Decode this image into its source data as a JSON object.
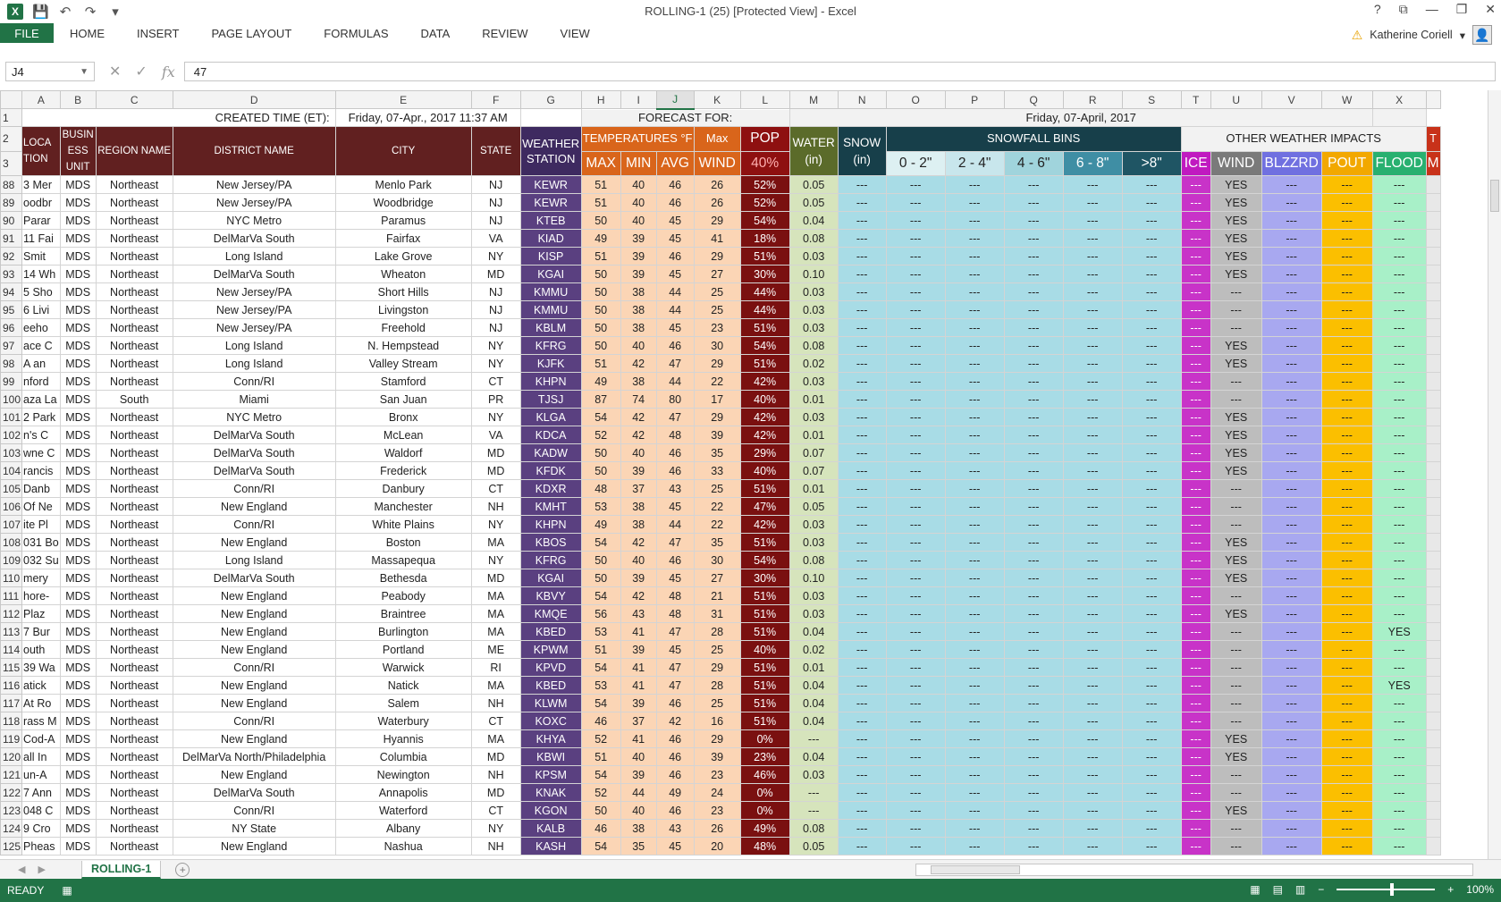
{
  "window": {
    "title": "ROLLING-1 (25)  [Protected View] - Excel",
    "help": "?",
    "controls": [
      "⧉",
      "—",
      "❐",
      "✕"
    ]
  },
  "qat": {
    "app_icon": "X",
    "save_icon": "save-icon",
    "undo_icon": "undo-icon",
    "redo_icon": "redo-icon",
    "customize_icon": "customize-icon"
  },
  "ribbon": {
    "file": "FILE",
    "tabs": [
      "HOME",
      "INSERT",
      "PAGE LAYOUT",
      "FORMULAS",
      "DATA",
      "REVIEW",
      "VIEW"
    ],
    "user": "Katherine Coriell"
  },
  "formula_bar": {
    "name_box": "J4",
    "fx": "fx",
    "value": "47"
  },
  "columns": [
    "A",
    "B",
    "C",
    "D",
    "E",
    "F",
    "G",
    "H",
    "I",
    "J",
    "K",
    "L",
    "M",
    "N",
    "O",
    "P",
    "Q",
    "R",
    "S",
    "T",
    "U",
    "V",
    "W",
    "X"
  ],
  "header": {
    "created_label": "CREATED TIME (ET):",
    "created_value": "Friday, 07-Apr., 2017 11:37 AM",
    "forecast_label": "FORECAST FOR:",
    "forecast_value": "Friday, 07-April, 2017",
    "location": "LOCA TION",
    "business_unit": "BUSIN ESS UNIT",
    "region": "REGION NAME",
    "district": "DISTRICT NAME",
    "city": "CITY",
    "state": "STATE",
    "station": "WEATHER STATION",
    "temps": "TEMPERATURES °F",
    "max_label": "Max",
    "pop": "POP",
    "water": "WATER (in)",
    "snow": "SNOW (in)",
    "snowfall_bins": "SNOWFALL BINS",
    "other_impacts": "OTHER WEATHER IMPACTS",
    "t_partial": "T",
    "m_partial": "M",
    "max": "MAX",
    "min": "MIN",
    "avg": "AVG",
    "wind": "WIND",
    "pop_val": "40%",
    "bin1": "0 - 2\"",
    "bin2": "2 - 4\"",
    "bin3": "4 - 6\"",
    "bin4": "6 - 8\"",
    "bin5": ">8\"",
    "ice": "ICE",
    "wind2": "WIND",
    "blzzrd": "BLZZRD",
    "pout": "POUT",
    "flood": "FLOOD"
  },
  "rows": [
    {
      "n": "88",
      "a": "3 Mer",
      "b": "MDS",
      "c": "Northeast",
      "d": "New Jersey/PA",
      "e": "Menlo Park",
      "f": "NJ",
      "g": "KEWR",
      "h": "51",
      "i": "40",
      "j": "46",
      "k": "26",
      "l": "52%",
      "m": "0.05",
      "u": "YES",
      "x": "---"
    },
    {
      "n": "89",
      "a": "oodbr",
      "b": "MDS",
      "c": "Northeast",
      "d": "New Jersey/PA",
      "e": "Woodbridge",
      "f": "NJ",
      "g": "KEWR",
      "h": "51",
      "i": "40",
      "j": "46",
      "k": "26",
      "l": "52%",
      "m": "0.05",
      "u": "YES",
      "x": "---"
    },
    {
      "n": "90",
      "a": "Parar",
      "b": "MDS",
      "c": "Northeast",
      "d": "NYC Metro",
      "e": "Paramus",
      "f": "NJ",
      "g": "KTEB",
      "h": "50",
      "i": "40",
      "j": "45",
      "k": "29",
      "l": "54%",
      "m": "0.04",
      "u": "YES",
      "x": "---"
    },
    {
      "n": "91",
      "a": "11 Fai",
      "b": "MDS",
      "c": "Northeast",
      "d": "DelMarVa South",
      "e": "Fairfax",
      "f": "VA",
      "g": "KIAD",
      "h": "49",
      "i": "39",
      "j": "45",
      "k": "41",
      "l": "18%",
      "m": "0.08",
      "u": "YES",
      "x": "---"
    },
    {
      "n": "92",
      "a": "Smit",
      "b": "MDS",
      "c": "Northeast",
      "d": "Long Island",
      "e": "Lake Grove",
      "f": "NY",
      "g": "KISP",
      "h": "51",
      "i": "39",
      "j": "46",
      "k": "29",
      "l": "51%",
      "m": "0.03",
      "u": "YES",
      "x": "---"
    },
    {
      "n": "93",
      "a": "14 Wh",
      "b": "MDS",
      "c": "Northeast",
      "d": "DelMarVa South",
      "e": "Wheaton",
      "f": "MD",
      "g": "KGAI",
      "h": "50",
      "i": "39",
      "j": "45",
      "k": "27",
      "l": "30%",
      "m": "0.10",
      "u": "YES",
      "x": "---"
    },
    {
      "n": "94",
      "a": "5 Sho",
      "b": "MDS",
      "c": "Northeast",
      "d": "New Jersey/PA",
      "e": "Short Hills",
      "f": "NJ",
      "g": "KMMU",
      "h": "50",
      "i": "38",
      "j": "44",
      "k": "25",
      "l": "44%",
      "m": "0.03",
      "u": "---",
      "x": "---"
    },
    {
      "n": "95",
      "a": "6 Livi",
      "b": "MDS",
      "c": "Northeast",
      "d": "New Jersey/PA",
      "e": "Livingston",
      "f": "NJ",
      "g": "KMMU",
      "h": "50",
      "i": "38",
      "j": "44",
      "k": "25",
      "l": "44%",
      "m": "0.03",
      "u": "---",
      "x": "---"
    },
    {
      "n": "96",
      "a": "eeho",
      "b": "MDS",
      "c": "Northeast",
      "d": "New Jersey/PA",
      "e": "Freehold",
      "f": "NJ",
      "g": "KBLM",
      "h": "50",
      "i": "38",
      "j": "45",
      "k": "23",
      "l": "51%",
      "m": "0.03",
      "u": "---",
      "x": "---"
    },
    {
      "n": "97",
      "a": "ace C",
      "b": "MDS",
      "c": "Northeast",
      "d": "Long Island",
      "e": "N. Hempstead",
      "f": "NY",
      "g": "KFRG",
      "h": "50",
      "i": "40",
      "j": "46",
      "k": "30",
      "l": "54%",
      "m": "0.08",
      "u": "YES",
      "x": "---"
    },
    {
      "n": "98",
      "a": "A an",
      "b": "MDS",
      "c": "Northeast",
      "d": "Long Island",
      "e": "Valley Stream",
      "f": "NY",
      "g": "KJFK",
      "h": "51",
      "i": "42",
      "j": "47",
      "k": "29",
      "l": "51%",
      "m": "0.02",
      "u": "YES",
      "x": "---"
    },
    {
      "n": "99",
      "a": "nford",
      "b": "MDS",
      "c": "Northeast",
      "d": "Conn/RI",
      "e": "Stamford",
      "f": "CT",
      "g": "KHPN",
      "h": "49",
      "i": "38",
      "j": "44",
      "k": "22",
      "l": "42%",
      "m": "0.03",
      "u": "---",
      "x": "---"
    },
    {
      "n": "100",
      "a": "aza La",
      "b": "MDS",
      "c": "South",
      "d": "Miami",
      "e": "San Juan",
      "f": "PR",
      "g": "TJSJ",
      "h": "87",
      "i": "74",
      "j": "80",
      "k": "17",
      "l": "40%",
      "m": "0.01",
      "u": "---",
      "x": "---"
    },
    {
      "n": "101",
      "a": "2 Park",
      "b": "MDS",
      "c": "Northeast",
      "d": "NYC Metro",
      "e": "Bronx",
      "f": "NY",
      "g": "KLGA",
      "h": "54",
      "i": "42",
      "j": "47",
      "k": "29",
      "l": "42%",
      "m": "0.03",
      "u": "YES",
      "x": "---"
    },
    {
      "n": "102",
      "a": "n's C",
      "b": "MDS",
      "c": "Northeast",
      "d": "DelMarVa South",
      "e": "McLean",
      "f": "VA",
      "g": "KDCA",
      "h": "52",
      "i": "42",
      "j": "48",
      "k": "39",
      "l": "42%",
      "m": "0.01",
      "u": "YES",
      "x": "---"
    },
    {
      "n": "103",
      "a": "wne C",
      "b": "MDS",
      "c": "Northeast",
      "d": "DelMarVa South",
      "e": "Waldorf",
      "f": "MD",
      "g": "KADW",
      "h": "50",
      "i": "40",
      "j": "46",
      "k": "35",
      "l": "29%",
      "m": "0.07",
      "u": "YES",
      "x": "---"
    },
    {
      "n": "104",
      "a": "rancis",
      "b": "MDS",
      "c": "Northeast",
      "d": "DelMarVa South",
      "e": "Frederick",
      "f": "MD",
      "g": "KFDK",
      "h": "50",
      "i": "39",
      "j": "46",
      "k": "33",
      "l": "40%",
      "m": "0.07",
      "u": "YES",
      "x": "---"
    },
    {
      "n": "105",
      "a": "Danb",
      "b": "MDS",
      "c": "Northeast",
      "d": "Conn/RI",
      "e": "Danbury",
      "f": "CT",
      "g": "KDXR",
      "h": "48",
      "i": "37",
      "j": "43",
      "k": "25",
      "l": "51%",
      "m": "0.01",
      "u": "---",
      "x": "---"
    },
    {
      "n": "106",
      "a": "Of Ne",
      "b": "MDS",
      "c": "Northeast",
      "d": "New England",
      "e": "Manchester",
      "f": "NH",
      "g": "KMHT",
      "h": "53",
      "i": "38",
      "j": "45",
      "k": "22",
      "l": "47%",
      "m": "0.05",
      "u": "---",
      "x": "---"
    },
    {
      "n": "107",
      "a": "ite Pl",
      "b": "MDS",
      "c": "Northeast",
      "d": "Conn/RI",
      "e": "White Plains",
      "f": "NY",
      "g": "KHPN",
      "h": "49",
      "i": "38",
      "j": "44",
      "k": "22",
      "l": "42%",
      "m": "0.03",
      "u": "---",
      "x": "---"
    },
    {
      "n": "108",
      "a": "031 Bo",
      "b": "MDS",
      "c": "Northeast",
      "d": "New England",
      "e": "Boston",
      "f": "MA",
      "g": "KBOS",
      "h": "54",
      "i": "42",
      "j": "47",
      "k": "35",
      "l": "51%",
      "m": "0.03",
      "u": "YES",
      "x": "---"
    },
    {
      "n": "109",
      "a": "032 Su",
      "b": "MDS",
      "c": "Northeast",
      "d": "Long Island",
      "e": "Massapequa",
      "f": "NY",
      "g": "KFRG",
      "h": "50",
      "i": "40",
      "j": "46",
      "k": "30",
      "l": "54%",
      "m": "0.08",
      "u": "YES",
      "x": "---"
    },
    {
      "n": "110",
      "a": "mery",
      "b": "MDS",
      "c": "Northeast",
      "d": "DelMarVa South",
      "e": "Bethesda",
      "f": "MD",
      "g": "KGAI",
      "h": "50",
      "i": "39",
      "j": "45",
      "k": "27",
      "l": "30%",
      "m": "0.10",
      "u": "YES",
      "x": "---"
    },
    {
      "n": "111",
      "a": "hore-",
      "b": "MDS",
      "c": "Northeast",
      "d": "New England",
      "e": "Peabody",
      "f": "MA",
      "g": "KBVY",
      "h": "54",
      "i": "42",
      "j": "48",
      "k": "21",
      "l": "51%",
      "m": "0.03",
      "u": "---",
      "x": "---"
    },
    {
      "n": "112",
      "a": "Plaz",
      "b": "MDS",
      "c": "Northeast",
      "d": "New England",
      "e": "Braintree",
      "f": "MA",
      "g": "KMQE",
      "h": "56",
      "i": "43",
      "j": "48",
      "k": "31",
      "l": "51%",
      "m": "0.03",
      "u": "YES",
      "x": "---"
    },
    {
      "n": "113",
      "a": "7 Bur",
      "b": "MDS",
      "c": "Northeast",
      "d": "New England",
      "e": "Burlington",
      "f": "MA",
      "g": "KBED",
      "h": "53",
      "i": "41",
      "j": "47",
      "k": "28",
      "l": "51%",
      "m": "0.04",
      "u": "---",
      "x": "YES"
    },
    {
      "n": "114",
      "a": "outh",
      "b": "MDS",
      "c": "Northeast",
      "d": "New England",
      "e": "Portland",
      "f": "ME",
      "g": "KPWM",
      "h": "51",
      "i": "39",
      "j": "45",
      "k": "25",
      "l": "40%",
      "m": "0.02",
      "u": "---",
      "x": "---"
    },
    {
      "n": "115",
      "a": "39 Wa",
      "b": "MDS",
      "c": "Northeast",
      "d": "Conn/RI",
      "e": "Warwick",
      "f": "RI",
      "g": "KPVD",
      "h": "54",
      "i": "41",
      "j": "47",
      "k": "29",
      "l": "51%",
      "m": "0.01",
      "u": "---",
      "x": "---"
    },
    {
      "n": "116",
      "a": "atick",
      "b": "MDS",
      "c": "Northeast",
      "d": "New England",
      "e": "Natick",
      "f": "MA",
      "g": "KBED",
      "h": "53",
      "i": "41",
      "j": "47",
      "k": "28",
      "l": "51%",
      "m": "0.04",
      "u": "---",
      "x": "YES"
    },
    {
      "n": "117",
      "a": "At Ro",
      "b": "MDS",
      "c": "Northeast",
      "d": "New England",
      "e": "Salem",
      "f": "NH",
      "g": "KLWM",
      "h": "54",
      "i": "39",
      "j": "46",
      "k": "25",
      "l": "51%",
      "m": "0.04",
      "u": "---",
      "x": "---"
    },
    {
      "n": "118",
      "a": "rass M",
      "b": "MDS",
      "c": "Northeast",
      "d": "Conn/RI",
      "e": "Waterbury",
      "f": "CT",
      "g": "KOXC",
      "h": "46",
      "i": "37",
      "j": "42",
      "k": "16",
      "l": "51%",
      "m": "0.04",
      "u": "---",
      "x": "---"
    },
    {
      "n": "119",
      "a": "Cod-A",
      "b": "MDS",
      "c": "Northeast",
      "d": "New England",
      "e": "Hyannis",
      "f": "MA",
      "g": "KHYA",
      "h": "52",
      "i": "41",
      "j": "46",
      "k": "29",
      "l": "0%",
      "m": "---",
      "u": "YES",
      "x": "---"
    },
    {
      "n": "120",
      "a": "all In",
      "b": "MDS",
      "c": "Northeast",
      "d": "DelMarVa North/Philadelphia",
      "e": "Columbia",
      "f": "MD",
      "g": "KBWI",
      "h": "51",
      "i": "40",
      "j": "46",
      "k": "39",
      "l": "23%",
      "m": "0.04",
      "u": "YES",
      "x": "---"
    },
    {
      "n": "121",
      "a": "un-A",
      "b": "MDS",
      "c": "Northeast",
      "d": "New England",
      "e": "Newington",
      "f": "NH",
      "g": "KPSM",
      "h": "54",
      "i": "39",
      "j": "46",
      "k": "23",
      "l": "46%",
      "m": "0.03",
      "u": "---",
      "x": "---"
    },
    {
      "n": "122",
      "a": "7 Ann",
      "b": "MDS",
      "c": "Northeast",
      "d": "DelMarVa South",
      "e": "Annapolis",
      "f": "MD",
      "g": "KNAK",
      "h": "52",
      "i": "44",
      "j": "49",
      "k": "24",
      "l": "0%",
      "m": "---",
      "u": "---",
      "x": "---"
    },
    {
      "n": "123",
      "a": "048 C",
      "b": "MDS",
      "c": "Northeast",
      "d": "Conn/RI",
      "e": "Waterford",
      "f": "CT",
      "g": "KGON",
      "h": "50",
      "i": "40",
      "j": "46",
      "k": "23",
      "l": "0%",
      "m": "---",
      "u": "YES",
      "x": "---"
    },
    {
      "n": "124",
      "a": "9 Cro",
      "b": "MDS",
      "c": "Northeast",
      "d": "NY State",
      "e": "Albany",
      "f": "NY",
      "g": "KALB",
      "h": "46",
      "i": "38",
      "j": "43",
      "k": "26",
      "l": "49%",
      "m": "0.08",
      "u": "---",
      "x": "---"
    },
    {
      "n": "125",
      "a": "Pheas",
      "b": "MDS",
      "c": "Northeast",
      "d": "New England",
      "e": "Nashua",
      "f": "NH",
      "g": "KASH",
      "h": "54",
      "i": "35",
      "j": "45",
      "k": "20",
      "l": "48%",
      "m": "0.05",
      "u": "---",
      "x": "---"
    }
  ],
  "dash": "---",
  "sheet_tab": "ROLLING-1",
  "status": {
    "ready": "READY",
    "zoom": "100%",
    "zoom_minus": "−",
    "zoom_plus": "+"
  }
}
